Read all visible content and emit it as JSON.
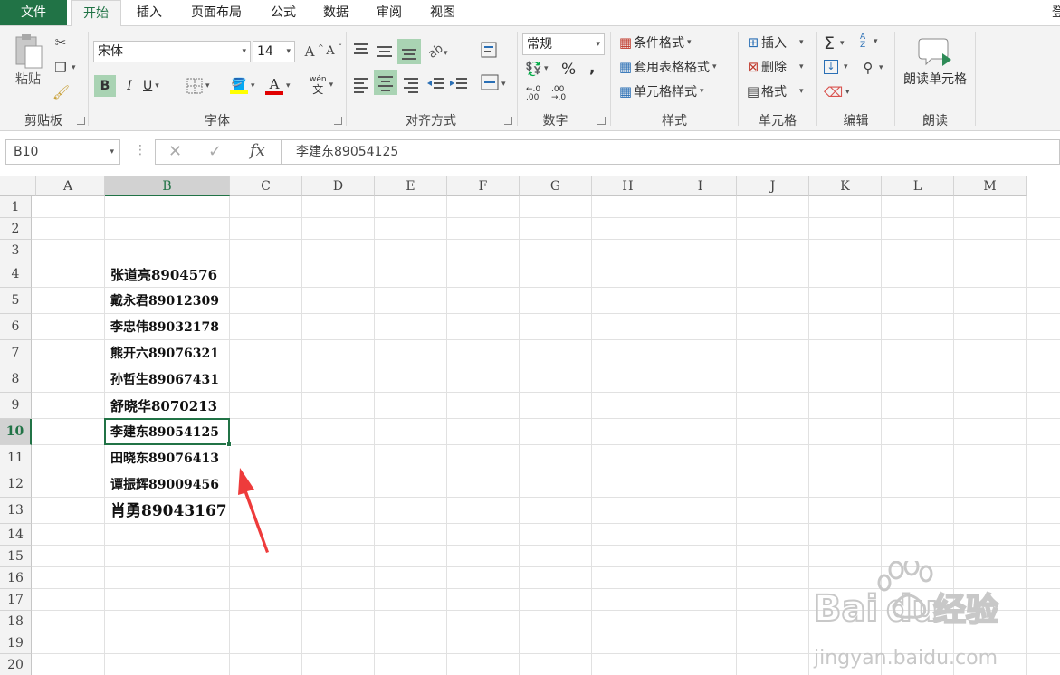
{
  "tabs": [
    "文件",
    "开始",
    "插入",
    "页面布局",
    "公式",
    "数据",
    "审阅",
    "视图"
  ],
  "tabs_right_partial": "登",
  "ribbon": {
    "clipboard": {
      "paste_label": "粘贴",
      "group_label": "剪贴板"
    },
    "font": {
      "font_name": "宋体",
      "font_size": "14",
      "grow_icon": "A",
      "shrink_icon": "A",
      "bold": "B",
      "italic": "I",
      "underline": "U",
      "font_color_glyph": "A",
      "wen_glyph": "wén",
      "wen_sub": "文",
      "group_label": "字体"
    },
    "alignment": {
      "group_label": "对齐方式"
    },
    "number": {
      "format": "常规",
      "percent": "%",
      "comma": ",",
      "inc_decimal": "←.0 .00",
      "dec_decimal": ".00 →.0",
      "group_label": "数字"
    },
    "styles": {
      "conditional": "条件格式",
      "table_format": "套用表格格式",
      "cell_styles": "单元格样式",
      "group_label": "样式"
    },
    "cells": {
      "insert": "插入",
      "delete": "删除",
      "format": "格式",
      "group_label": "单元格"
    },
    "editing": {
      "sigma": "Σ",
      "sort_glyph": "A Z",
      "group_label": "编辑"
    },
    "read": {
      "read_cells": "朗读单元格",
      "group_label": "朗读"
    }
  },
  "formula_bar": {
    "name_box": "B10",
    "cancel_glyph": "✕",
    "enter_glyph": "✓",
    "fx": "fx",
    "content": "李建东89054125"
  },
  "columns": [
    "A",
    "B",
    "C",
    "D",
    "E",
    "F",
    "G",
    "H",
    "I",
    "J",
    "K",
    "L",
    "M"
  ],
  "rows": [
    "1",
    "2",
    "3",
    "4",
    "5",
    "6",
    "7",
    "8",
    "9",
    "10",
    "11",
    "12",
    "13",
    "14",
    "15",
    "16",
    "17",
    "18",
    "19",
    "20"
  ],
  "selected_cell": "B10",
  "cells_B": {
    "4": "张道亮8904576",
    "5": "戴永君89012309",
    "6": "李忠伟89032178",
    "7": "熊开六89076321",
    "8": "孙哲生89067431",
    "9": "舒晓华8070213",
    "10": "李建东89054125",
    "11": "田晓东89076413",
    "12": "谭振辉89009456",
    "13": "肖勇89043167"
  },
  "watermark": {
    "brand": "Bai",
    "brand2": "du",
    "cn": "经验",
    "url": "jingyan.baidu.com"
  },
  "colors": {
    "accent": "#217346",
    "arrow": "#ee3b3b"
  }
}
